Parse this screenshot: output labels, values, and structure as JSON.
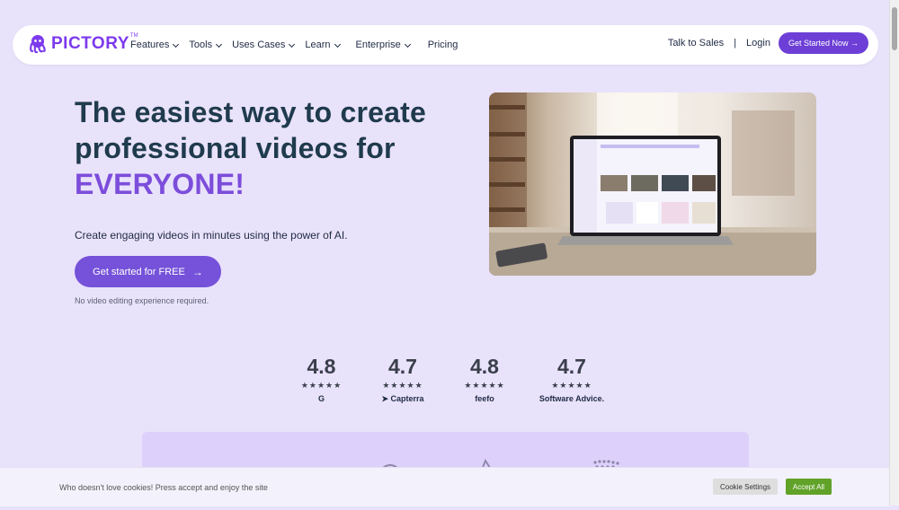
{
  "nav": {
    "logo_text": "PICTORY",
    "logo_tm": "TM",
    "menu": [
      {
        "label": "Features"
      },
      {
        "label": "Tools"
      },
      {
        "label": "Uses Cases"
      },
      {
        "label": "Learn"
      },
      {
        "label": "Enterprise"
      },
      {
        "label": "Pricing"
      }
    ],
    "talk_to_sales": "Talk to Sales",
    "separator": "|",
    "login": "Login",
    "get_started": "Get Started Now →"
  },
  "hero": {
    "title_line1": "The easiest way to create",
    "title_line2": "professional videos for",
    "title_accent": "EVERYONE!",
    "subtitle": "Create engaging videos in minutes using the power of AI.",
    "cta_label": "Get started for FREE",
    "cta_arrow": "→",
    "note": "No video editing experience required."
  },
  "ratings": [
    {
      "score": "4.8",
      "stars": "★★★★★",
      "brand": "G"
    },
    {
      "score": "4.7",
      "stars": "★★★★★",
      "brand": "Capterra"
    },
    {
      "score": "4.8",
      "stars": "★★★★★",
      "brand": "feefo"
    },
    {
      "score": "4.7",
      "stars": "★★★★★",
      "brand": "Software Advice."
    }
  ],
  "cookie": {
    "text": "Who doesn't love cookies! Press accept and enjoy the site",
    "settings_label": "Cookie Settings",
    "accept_label": "Accept All"
  },
  "colors": {
    "background": "#e9e2fb",
    "brand_purple": "#6d3fd6",
    "accent_text": "#7c4ddb",
    "accept_green": "#61a229"
  }
}
